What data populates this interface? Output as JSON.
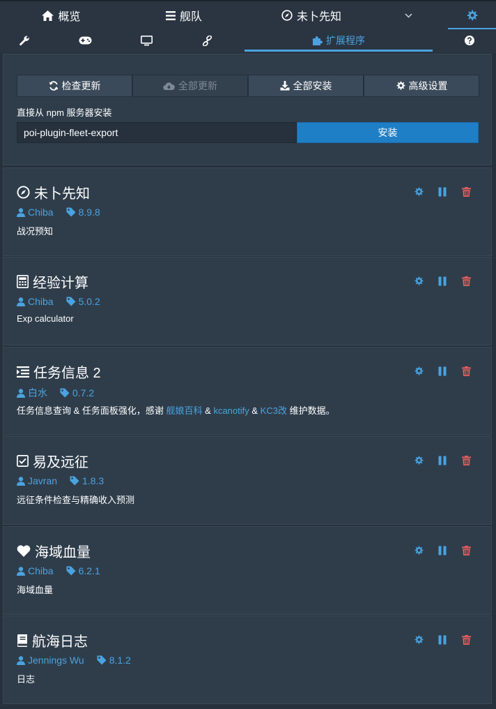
{
  "topnav": {
    "tabs": [
      {
        "label": "概览",
        "icon": "home-icon"
      },
      {
        "label": "舰队",
        "icon": "list-icon"
      },
      {
        "label": "未卜先知",
        "icon": "compass-icon"
      }
    ],
    "dropdown_icon": "chevron-down-icon",
    "settings_icon": "gear-icon"
  },
  "subnav": {
    "tabs": [
      {
        "icon": "wrench-icon"
      },
      {
        "icon": "gamepad-icon"
      },
      {
        "icon": "monitor-icon"
      },
      {
        "icon": "link-icon"
      },
      {
        "label": "扩展程序",
        "icon": "puzzle-icon",
        "active": true
      },
      {
        "icon": "question-icon"
      }
    ]
  },
  "control": {
    "buttons": [
      {
        "label": "检查更新",
        "icon": "refresh-icon",
        "disabled": false
      },
      {
        "label": "全部更新",
        "icon": "cloud-download-icon",
        "disabled": true
      },
      {
        "label": "全部安装",
        "icon": "download-icon",
        "disabled": false
      },
      {
        "label": "高级设置",
        "icon": "gear-icon",
        "disabled": false
      }
    ],
    "npm_label": "直接从 npm 服务器安装",
    "npm_value": "poi-plugin-fleet-export",
    "install_label": "安装"
  },
  "plugins": [
    {
      "name": "未卜先知",
      "icon": "compass-icon",
      "author": "Chiba",
      "version": "8.9.8",
      "description": "战况预知"
    },
    {
      "name": "经验计算",
      "icon": "calculator-icon",
      "author": "Chiba",
      "version": "5.0.2",
      "description": "Exp calculator"
    },
    {
      "name": "任务信息 2",
      "icon": "indent-icon",
      "author": "白水",
      "version": "0.7.2",
      "description_parts": [
        {
          "text": "任务信息查询 & 任务面板强化，感谢 ",
          "link": false
        },
        {
          "text": "舰娘百科",
          "link": true
        },
        {
          "text": " & ",
          "link": false
        },
        {
          "text": "kcanotify",
          "link": true
        },
        {
          "text": " & ",
          "link": false
        },
        {
          "text": "KC3改",
          "link": true
        },
        {
          "text": " 维护数据。",
          "link": false
        }
      ]
    },
    {
      "name": "易及远征",
      "icon": "checkbox-icon",
      "author": "Javran",
      "version": "1.8.3",
      "description": "远征条件检查与精确收入预测"
    },
    {
      "name": "海域血量",
      "icon": "heart-icon",
      "author": "Chiba",
      "version": "6.2.1",
      "description": "海域血量"
    },
    {
      "name": "航海日志",
      "icon": "book-icon",
      "author": "Jennings Wu",
      "version": "8.1.2",
      "description": "日志"
    }
  ],
  "colors": {
    "accent": "#4aa3df",
    "danger": "#e25d5d",
    "panel": "#2f3d4b",
    "background": "#26313d",
    "install_button": "#1f7fc6"
  }
}
